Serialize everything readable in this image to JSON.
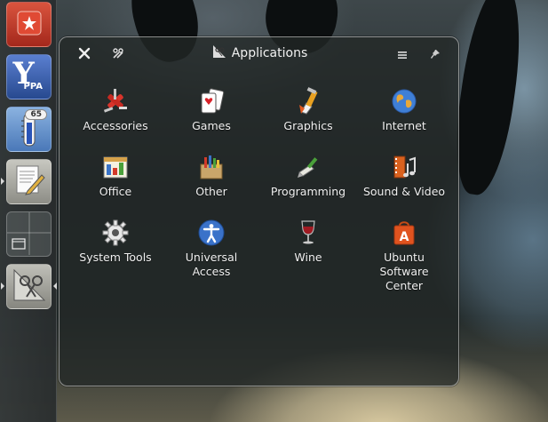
{
  "dash": {
    "title": "Applications",
    "close_icon": "close-icon",
    "settings_icon": "wrench-icon",
    "menu_icon": "menu-icon",
    "pin_icon": "pin-icon",
    "category_icon": "applications-icon"
  },
  "launcher": {
    "items": [
      {
        "name": "wunderlist",
        "icon": "wunderlist-icon"
      },
      {
        "name": "y-ppa-manager",
        "icon": "yppa-icon",
        "text": "PPA"
      },
      {
        "name": "indicator-thermometer",
        "icon": "thermometer-icon",
        "badge": "65"
      },
      {
        "name": "text-editor",
        "icon": "text-editor-icon"
      },
      {
        "name": "workspace-switcher",
        "icon": "workspace-icon"
      },
      {
        "name": "applications",
        "icon": "applications-icon"
      }
    ]
  },
  "apps": [
    {
      "label": "Accessories",
      "icon": "accessories-icon"
    },
    {
      "label": "Games",
      "icon": "games-icon"
    },
    {
      "label": "Graphics",
      "icon": "graphics-icon"
    },
    {
      "label": "Internet",
      "icon": "internet-icon"
    },
    {
      "label": "Office",
      "icon": "office-icon"
    },
    {
      "label": "Other",
      "icon": "other-icon"
    },
    {
      "label": "Programming",
      "icon": "programming-icon"
    },
    {
      "label": "Sound & Video",
      "icon": "sound-video-icon"
    },
    {
      "label": "System Tools",
      "icon": "system-tools-icon"
    },
    {
      "label": "Universal\nAccess",
      "icon": "universal-access-icon"
    },
    {
      "label": "Wine",
      "icon": "wine-icon"
    },
    {
      "label": "Ubuntu\nSoftware\nCenter",
      "icon": "software-center-icon"
    }
  ],
  "colors": {
    "accent_orange": "#e0531f",
    "wunderlist_red": "#c33a2a",
    "yppa_blue": "#2c5aa8"
  }
}
